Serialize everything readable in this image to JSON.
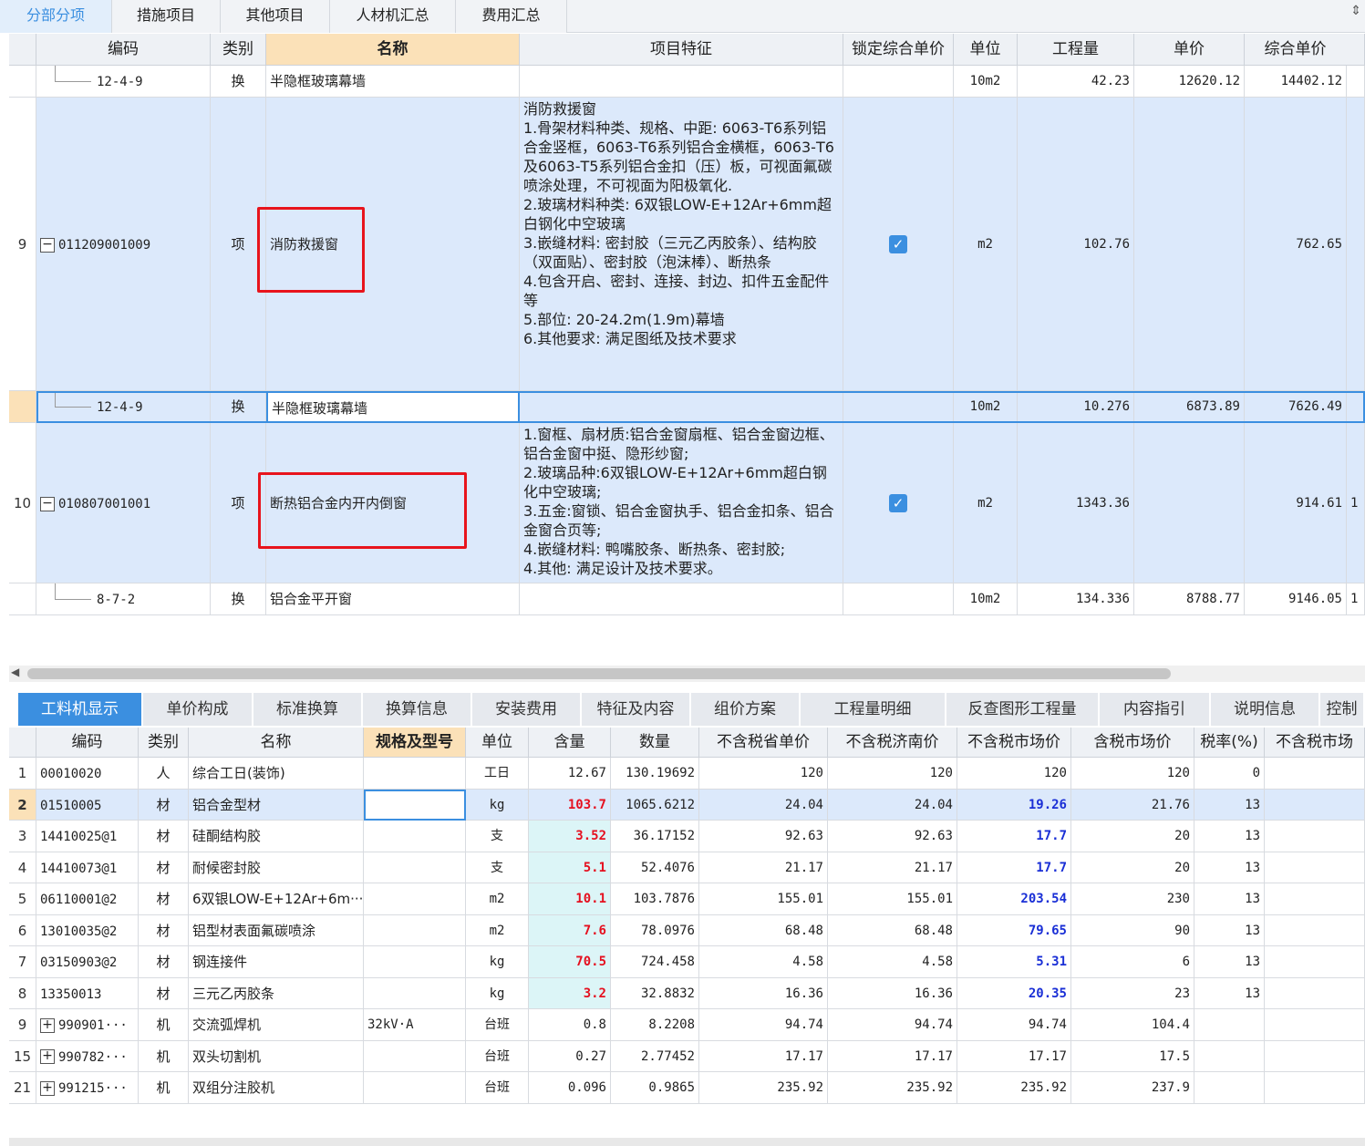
{
  "top_tabs": [
    "分部分项",
    "措施项目",
    "其他项目",
    "人材机汇总",
    "费用汇总"
  ],
  "grid": {
    "headers": [
      "编码",
      "类别",
      "名称",
      "项目特征",
      "锁定综合单价",
      "单位",
      "工程量",
      "单价",
      "综合单价"
    ],
    "rows": [
      {
        "no": "",
        "code": "12-4-9",
        "type": "换",
        "name": "半隐框玻璃幕墙",
        "feature": "",
        "locked": false,
        "unit": "10m2",
        "qty": "42.23",
        "price": "12620.12",
        "comp": "14402.12",
        "extra": ""
      },
      {
        "no": "9",
        "code": "011209001009",
        "type": "项",
        "name": "消防救援窗",
        "feature": "消防救援窗\n1.骨架材料种类、规格、中距: 6063-T6系列铝合金竖框，6063-T6系列铝合金横框，6063-T6及6063-T5系列铝合金扣（压）板，可视面氟碳喷涂处理，不可视面为阳极氧化.\n2.玻璃材料种类: 6双银LOW-E+12Ar+6mm超白钢化中空玻璃\n3.嵌缝材料: 密封胶（三元乙丙胶条）、结构胶（双面贴）、密封胶（泡沫棒）、断热条\n4.包含开启、密封、连接、封边、扣件五金配件等\n5.部位: 20-24.2m(1.9m)幕墙\n6.其他要求: 满足图纸及技术要求",
        "locked": true,
        "unit": "m2",
        "qty": "102.76",
        "price": "",
        "comp": "762.65",
        "extra": ""
      },
      {
        "no": "",
        "code": "12-4-9",
        "type": "换",
        "name": "半隐框玻璃幕墙",
        "feature": "",
        "locked": false,
        "unit": "10m2",
        "qty": "10.276",
        "price": "6873.89",
        "comp": "7626.49",
        "extra": ""
      },
      {
        "no": "10",
        "code": "010807001001",
        "type": "项",
        "name": "断热铝合金内开内倒窗",
        "feature": "1.窗框、扇材质:铝合金窗扇框、铝合金窗边框、铝合金窗中挺、隐形纱窗;\n2.玻璃品种:6双银LOW-E+12Ar+6mm超白钢化中空玻璃;\n3.五金:窗锁、铝合金窗执手、铝合金扣条、铝合金窗合页等;\n4.嵌缝材料: 鸭嘴胶条、断热条、密封胶;\n4.其他: 满足设计及技术要求。",
        "locked": true,
        "unit": "m2",
        "qty": "1343.36",
        "price": "",
        "comp": "914.61",
        "extra": "1"
      },
      {
        "no": "",
        "code": "8-7-2",
        "type": "换",
        "name": "铝合金平开窗",
        "feature": "",
        "locked": false,
        "unit": "10m2",
        "qty": "134.336",
        "price": "8788.77",
        "comp": "9146.05",
        "extra": "1"
      }
    ]
  },
  "bottom_tabs": [
    "工料机显示",
    "单价构成",
    "标准换算",
    "换算信息",
    "安装费用",
    "特征及内容",
    "组价方案",
    "工程量明细",
    "反查图形工程量",
    "内容指引",
    "说明信息",
    "控制"
  ],
  "detail": {
    "headers": [
      "编码",
      "类别",
      "名称",
      "规格及型号",
      "单位",
      "含量",
      "数量",
      "不含税省单价",
      "不含税济南价",
      "不含税市场价",
      "含税市场价",
      "税率(%)",
      "不含税市场"
    ],
    "rows": [
      {
        "no": "1",
        "code": "00010020",
        "type": "人",
        "name": "综合工日(装饰)",
        "spec": "",
        "unit": "工日",
        "amt": "12.67",
        "qty": "130.19692",
        "p1": "120",
        "p2": "120",
        "p3": "120",
        "p4": "120",
        "tax": "0",
        "expand": false,
        "hl": false
      },
      {
        "no": "2",
        "code": "01510005",
        "type": "材",
        "name": "铝合金型材",
        "spec": "",
        "unit": "kg",
        "amt": "103.7",
        "qty": "1065.6212",
        "p1": "24.04",
        "p2": "24.04",
        "p3": "19.26",
        "p4": "21.76",
        "tax": "13",
        "expand": false,
        "hl": true
      },
      {
        "no": "3",
        "code": "14410025@1",
        "type": "材",
        "name": "硅酮结构胶",
        "spec": "",
        "unit": "支",
        "amt": "3.52",
        "qty": "36.17152",
        "p1": "92.63",
        "p2": "92.63",
        "p3": "17.7",
        "p4": "20",
        "tax": "13",
        "expand": false,
        "hl": true
      },
      {
        "no": "4",
        "code": "14410073@1",
        "type": "材",
        "name": "耐候密封胶",
        "spec": "",
        "unit": "支",
        "amt": "5.1",
        "qty": "52.4076",
        "p1": "21.17",
        "p2": "21.17",
        "p3": "17.7",
        "p4": "20",
        "tax": "13",
        "expand": false,
        "hl": true
      },
      {
        "no": "5",
        "code": "06110001@2",
        "type": "材",
        "name": "6双银LOW-E+12Ar+6m···",
        "spec": "",
        "unit": "m2",
        "amt": "10.1",
        "qty": "103.7876",
        "p1": "155.01",
        "p2": "155.01",
        "p3": "203.54",
        "p4": "230",
        "tax": "13",
        "expand": false,
        "hl": true
      },
      {
        "no": "6",
        "code": "13010035@2",
        "type": "材",
        "name": "铝型材表面氟碳喷涂",
        "spec": "",
        "unit": "m2",
        "amt": "7.6",
        "qty": "78.0976",
        "p1": "68.48",
        "p2": "68.48",
        "p3": "79.65",
        "p4": "90",
        "tax": "13",
        "expand": false,
        "hl": true
      },
      {
        "no": "7",
        "code": "03150903@2",
        "type": "材",
        "name": "钢连接件",
        "spec": "",
        "unit": "kg",
        "amt": "70.5",
        "qty": "724.458",
        "p1": "4.58",
        "p2": "4.58",
        "p3": "5.31",
        "p4": "6",
        "tax": "13",
        "expand": false,
        "hl": true
      },
      {
        "no": "8",
        "code": "13350013",
        "type": "材",
        "name": "三元乙丙胶条",
        "spec": "",
        "unit": "kg",
        "amt": "3.2",
        "qty": "32.8832",
        "p1": "16.36",
        "p2": "16.36",
        "p3": "20.35",
        "p4": "23",
        "tax": "13",
        "expand": false,
        "hl": true
      },
      {
        "no": "9",
        "code": "990901···",
        "type": "机",
        "name": "交流弧焊机",
        "spec": "32kV·A",
        "unit": "台班",
        "amt": "0.8",
        "qty": "8.2208",
        "p1": "94.74",
        "p2": "94.74",
        "p3": "94.74",
        "p4": "104.4",
        "tax": "",
        "expand": true,
        "hl": false
      },
      {
        "no": "15",
        "code": "990782···",
        "type": "机",
        "name": "双头切割机",
        "spec": "",
        "unit": "台班",
        "amt": "0.27",
        "qty": "2.77452",
        "p1": "17.17",
        "p2": "17.17",
        "p3": "17.17",
        "p4": "17.5",
        "tax": "",
        "expand": true,
        "hl": false
      },
      {
        "no": "21",
        "code": "991215···",
        "type": "机",
        "name": "双组分注胶机",
        "spec": "",
        "unit": "台班",
        "amt": "0.096",
        "qty": "0.9865",
        "p1": "235.92",
        "p2": "235.92",
        "p3": "235.92",
        "p4": "237.9",
        "tax": "",
        "expand": true,
        "hl": false
      }
    ]
  },
  "icons": {
    "sort": "sort-arrows-icon",
    "expand": "expand-plus-icon",
    "collapse": "collapse-minus-icon",
    "check": "checkbox-checked-icon"
  },
  "colors": {
    "accent": "#3b8fe0",
    "highlight_row": "#dce9fb",
    "red_text": "#e5101f",
    "blue_text": "#1a2fd6",
    "annotation_box": "#e8141c"
  }
}
